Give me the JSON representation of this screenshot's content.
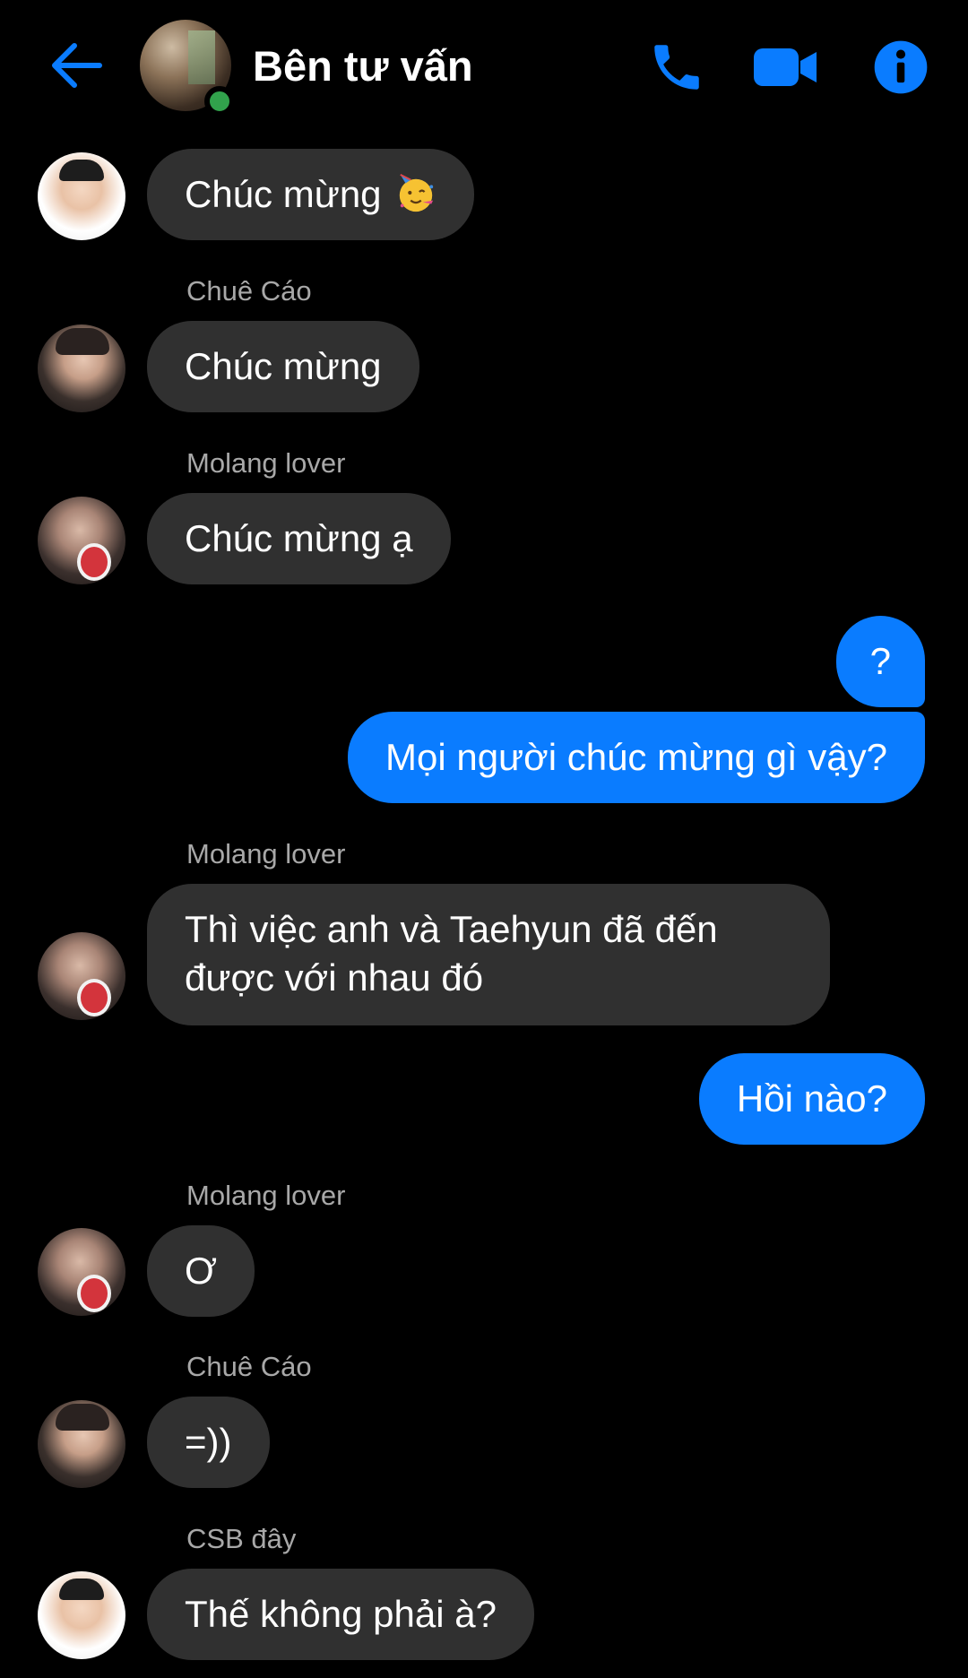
{
  "header": {
    "title": "Bên tư vấn",
    "icons": [
      "back-arrow-icon",
      "phone-icon",
      "video-camera-icon",
      "info-icon"
    ],
    "accent_color": "#0a7cff",
    "online_color": "#31a24c"
  },
  "messages": [
    {
      "direction": "incoming",
      "sender": "",
      "avatar": "kid",
      "text": "Chúc mừng",
      "emoji": "partying-face-emoji"
    },
    {
      "direction": "incoming",
      "sender": "Chuê Cáo",
      "avatar": "boy",
      "text": "Chúc mừng"
    },
    {
      "direction": "incoming",
      "sender": "Molang lover",
      "avatar": "molang",
      "text": "Chúc mừng ạ"
    },
    {
      "direction": "outgoing",
      "text": "?"
    },
    {
      "direction": "outgoing",
      "text": "Mọi người chúc mừng gì vậy?"
    },
    {
      "direction": "incoming",
      "sender": "Molang lover",
      "avatar": "molang",
      "text_lines": [
        "Thì việc anh và Taehyun đã đến",
        "được với nhau đó"
      ]
    },
    {
      "direction": "outgoing",
      "text": "Hồi nào?"
    },
    {
      "direction": "incoming",
      "sender": "Molang lover",
      "avatar": "molang",
      "text": "Ơ"
    },
    {
      "direction": "incoming",
      "sender": "Chuê Cáo",
      "avatar": "boy",
      "text": "=))"
    },
    {
      "direction": "incoming",
      "sender": "CSB đây",
      "avatar": "kid",
      "text": "Thế không phải à?"
    }
  ],
  "colors": {
    "background": "#000000",
    "incoming_bubble": "#303030",
    "outgoing_bubble": "#0a7cff",
    "sender_name": "#a8a8a8"
  }
}
